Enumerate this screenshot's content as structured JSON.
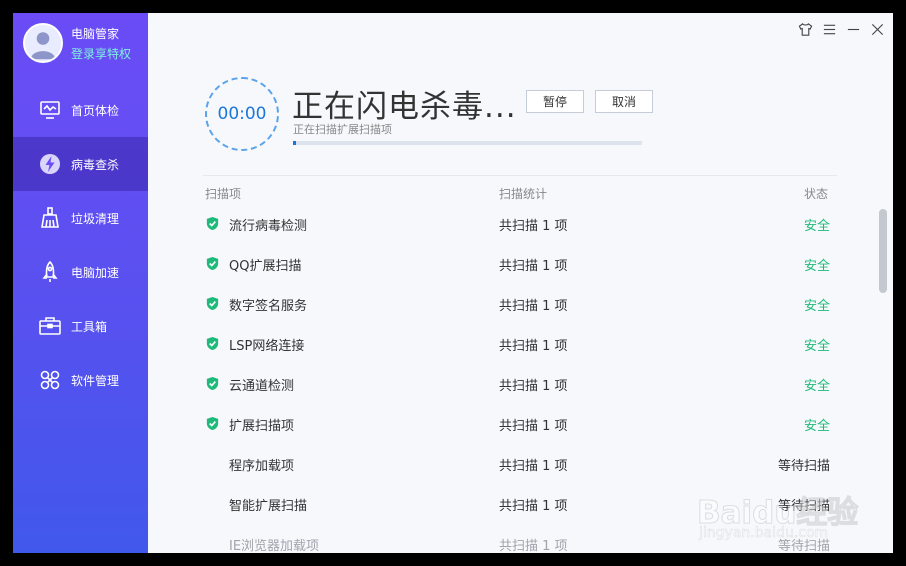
{
  "sidebar": {
    "app_name": "电脑管家",
    "login_link": "登录享特权",
    "items": [
      {
        "label": "首页体检",
        "icon": "monitor-icon"
      },
      {
        "label": "病毒查杀",
        "icon": "lightning-shield-icon"
      },
      {
        "label": "垃圾清理",
        "icon": "broom-icon"
      },
      {
        "label": "电脑加速",
        "icon": "rocket-icon"
      },
      {
        "label": "工具箱",
        "icon": "toolbox-icon"
      },
      {
        "label": "软件管理",
        "icon": "software-icon"
      }
    ],
    "active_index": 1
  },
  "window_controls": [
    "skin-icon",
    "menu-icon",
    "minimize-icon",
    "close-icon"
  ],
  "scan": {
    "timer": "00:00",
    "title": "正在闪电杀毒...",
    "pause_label": "暂停",
    "cancel_label": "取消",
    "subtitle": "正在扫描扩展扫描项",
    "progress_fraction": 0.01
  },
  "table": {
    "headers": {
      "item": "扫描项",
      "stat": "扫描统计",
      "state": "状态"
    },
    "rows": [
      {
        "name": "流行病毒检测",
        "stat": "共扫描 1 项",
        "state": "安全",
        "checked": true
      },
      {
        "name": "QQ扩展扫描",
        "stat": "共扫描 1 项",
        "state": "安全",
        "checked": true
      },
      {
        "name": "数字签名服务",
        "stat": "共扫描 1 项",
        "state": "安全",
        "checked": true
      },
      {
        "name": "LSP网络连接",
        "stat": "共扫描 1 项",
        "state": "安全",
        "checked": true
      },
      {
        "name": "云通道检测",
        "stat": "共扫描 1 项",
        "state": "安全",
        "checked": true
      },
      {
        "name": "扩展扫描项",
        "stat": "共扫描 1 项",
        "state": "安全",
        "checked": true
      },
      {
        "name": "程序加载项",
        "stat": "共扫描 1 项",
        "state": "等待扫描",
        "checked": false
      },
      {
        "name": "智能扩展扫描",
        "stat": "共扫描 1 项",
        "state": "等待扫描",
        "checked": false
      },
      {
        "name": "IE浏览器加载项",
        "stat": "共扫描 1 项",
        "state": "等待扫描",
        "checked": false
      }
    ]
  },
  "watermark": {
    "brand": "Baidu经验",
    "url": "jingyan.baidu.com"
  },
  "colors": {
    "accent_blue": "#1a78dc",
    "safe_green": "#1fba7a",
    "sidebar_top": "#6b4cf6",
    "sidebar_bottom": "#4158ec"
  }
}
